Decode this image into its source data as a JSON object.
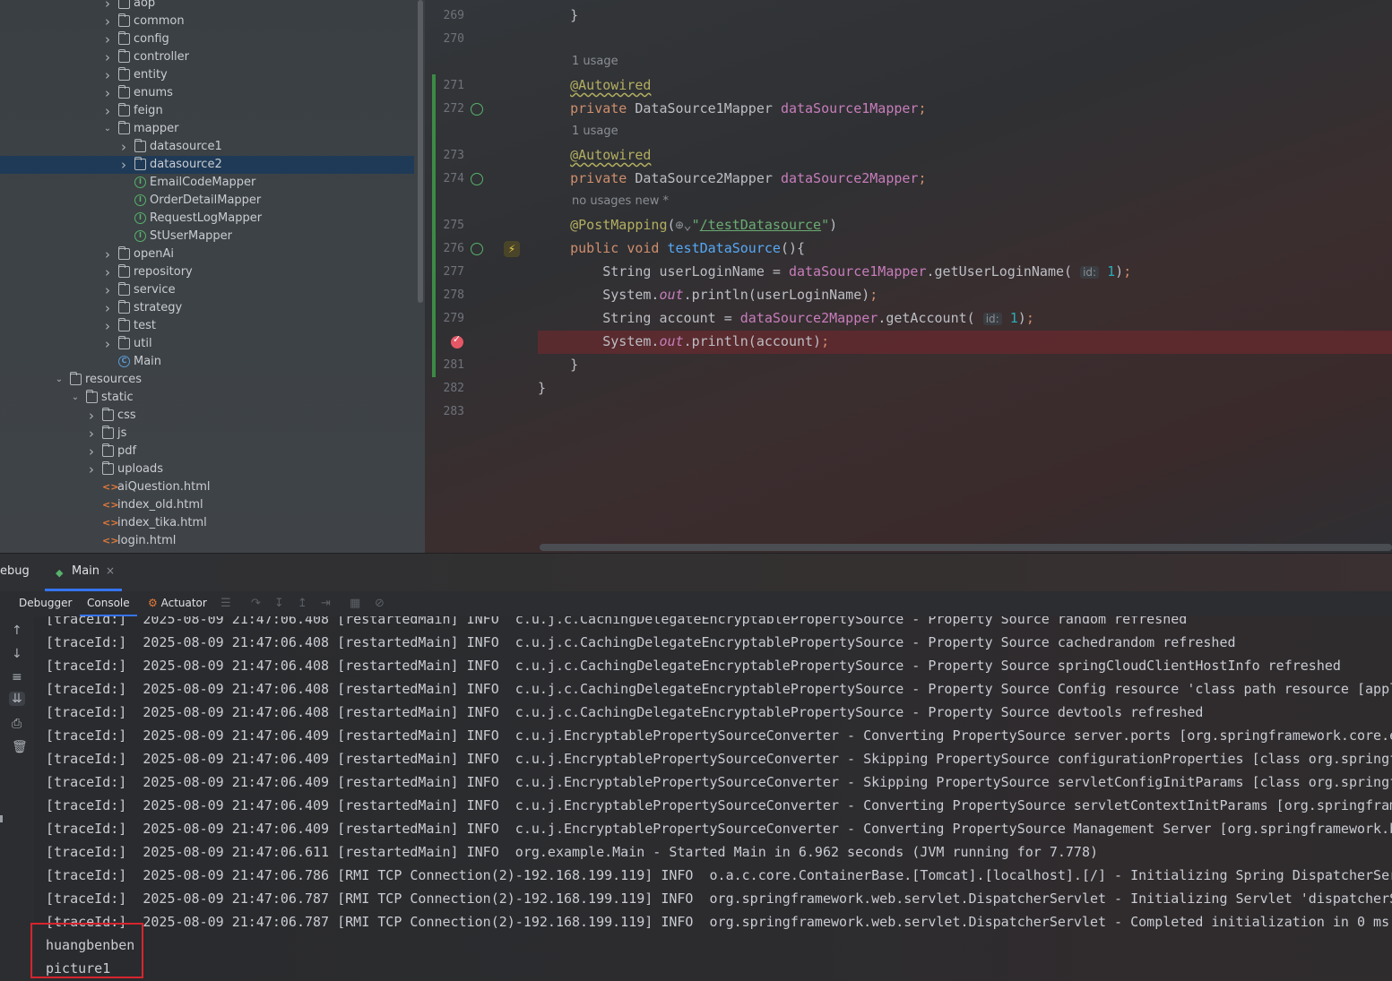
{
  "project_tree": {
    "items": [
      {
        "label": "aop",
        "type": "folder",
        "indent": 1,
        "expanded": false,
        "partial": true
      },
      {
        "label": "common",
        "type": "folder",
        "indent": 1,
        "expanded": false
      },
      {
        "label": "config",
        "type": "folder",
        "indent": 1,
        "expanded": false
      },
      {
        "label": "controller",
        "type": "folder",
        "indent": 1,
        "expanded": false
      },
      {
        "label": "entity",
        "type": "folder",
        "indent": 1,
        "expanded": false
      },
      {
        "label": "enums",
        "type": "folder",
        "indent": 1,
        "expanded": false
      },
      {
        "label": "feign",
        "type": "folder",
        "indent": 1,
        "expanded": false
      },
      {
        "label": "mapper",
        "type": "folder",
        "indent": 1,
        "expanded": true
      },
      {
        "label": "datasource1",
        "type": "folder",
        "indent": 2,
        "expanded": false
      },
      {
        "label": "datasource2",
        "type": "folder",
        "indent": 2,
        "expanded": false,
        "selected": true
      },
      {
        "label": "EmailCodeMapper",
        "type": "interface",
        "indent": 2
      },
      {
        "label": "OrderDetailMapper",
        "type": "interface",
        "indent": 2
      },
      {
        "label": "RequestLogMapper",
        "type": "interface",
        "indent": 2
      },
      {
        "label": "StUserMapper",
        "type": "interface",
        "indent": 2
      },
      {
        "label": "openAi",
        "type": "folder",
        "indent": 1,
        "expanded": false
      },
      {
        "label": "repository",
        "type": "folder",
        "indent": 1,
        "expanded": false
      },
      {
        "label": "service",
        "type": "folder",
        "indent": 1,
        "expanded": false
      },
      {
        "label": "strategy",
        "type": "folder",
        "indent": 1,
        "expanded": false
      },
      {
        "label": "test",
        "type": "folder",
        "indent": 1,
        "expanded": false
      },
      {
        "label": "util",
        "type": "folder",
        "indent": 1,
        "expanded": false
      },
      {
        "label": "Main",
        "type": "class",
        "indent": 1
      },
      {
        "label": "resources",
        "type": "folder",
        "indent": -2,
        "expanded": true
      },
      {
        "label": "static",
        "type": "folder",
        "indent": -1,
        "expanded": true
      },
      {
        "label": "css",
        "type": "folder",
        "indent": 0,
        "expanded": false
      },
      {
        "label": "js",
        "type": "folder",
        "indent": 0,
        "expanded": false
      },
      {
        "label": "pdf",
        "type": "folder",
        "indent": 0,
        "expanded": false
      },
      {
        "label": "uploads",
        "type": "folder",
        "indent": 0,
        "expanded": false
      },
      {
        "label": "aiQuestion.html",
        "type": "html",
        "indent": 0
      },
      {
        "label": "index_old.html",
        "type": "html",
        "indent": 0
      },
      {
        "label": "index_tika.html",
        "type": "html",
        "indent": 0
      },
      {
        "label": "login.html",
        "type": "html",
        "indent": 0
      }
    ]
  },
  "editor": {
    "lines": [
      {
        "num": "269",
        "html": "    }"
      },
      {
        "num": "270",
        "html": ""
      },
      {
        "hint": "1 usage"
      },
      {
        "num": "271",
        "html": "    <span class=\"ann\">@Autowired</span>",
        "changed": true
      },
      {
        "num": "272",
        "html": "    <span class=\"kw\">private</span> DataSource1Mapper <span class=\"fld\">dataSource1Mapper</span><span class=\"kw\">;</span>",
        "changed": true,
        "icon": "bean-nav"
      },
      {
        "hint": "1 usage",
        "changed": true
      },
      {
        "num": "273",
        "html": "    <span class=\"ann\">@Autowired</span>",
        "changed": true
      },
      {
        "num": "274",
        "html": "    <span class=\"kw\">private</span> DataSource2Mapper <span class=\"fld\">dataSource2Mapper</span><span class=\"kw\">;</span>",
        "changed": true,
        "icon": "bean-nav"
      },
      {
        "hint": "no usages   new *",
        "changed": true
      },
      {
        "num": "275",
        "html": "    <span class=\"annp\">@PostMapping</span>(<span style=\"color:#8a8e94\">⊕⌄</span><span class=\"str\">\"<u>/testDatasource</u>\"</span>)",
        "changed": true
      },
      {
        "num": "276",
        "html": "    <span class=\"kw\">public void</span> <span class=\"fn\">testDataSource</span>(){",
        "changed": true,
        "icon": "web-endpoint"
      },
      {
        "num": "277",
        "html": "        String userLoginName = <span class=\"fld\">dataSource1Mapper</span>.getUserLoginName( <span class=\"param-hint\">id:</span> <span class=\"num\">1</span>)<span class=\"kw\">;</span>",
        "changed": true
      },
      {
        "num": "278",
        "html": "        System.<span class=\"fld it\">out</span>.println(userLoginName)<span class=\"kw\">;</span>",
        "changed": true
      },
      {
        "num": "279",
        "html": "        String account = <span class=\"fld\">dataSource2Mapper</span>.getAccount( <span class=\"param-hint\">id:</span> <span class=\"num\">1</span>)<span class=\"kw\">;</span>",
        "changed": true
      },
      {
        "num": "",
        "html": "        System.<span class=\"fld it\">out</span>.println(account)<span class=\"kw\">;</span>",
        "changed": true,
        "breakpoint": true
      },
      {
        "num": "281",
        "html": "    }",
        "changed": true
      },
      {
        "num": "282",
        "html": "}"
      },
      {
        "num": "283",
        "html": ""
      }
    ]
  },
  "debug": {
    "title": "ebug",
    "session_tab": "Main",
    "session_close": "×",
    "tabs": {
      "debugger": "Debugger",
      "console": "Console",
      "actuator": "Actuator"
    },
    "console_lines": [
      "[traceId:]  2025-08-09 21:47:06.408 [restartedMain] INFO  c.u.j.c.CachingDelegateEncryptablePropertySource - Property Source random refreshed",
      "[traceId:]  2025-08-09 21:47:06.408 [restartedMain] INFO  c.u.j.c.CachingDelegateEncryptablePropertySource - Property Source cachedrandom refreshed",
      "[traceId:]  2025-08-09 21:47:06.408 [restartedMain] INFO  c.u.j.c.CachingDelegateEncryptablePropertySource - Property Source springCloudClientHostInfo refreshed",
      "[traceId:]  2025-08-09 21:47:06.408 [restartedMain] INFO  c.u.j.c.CachingDelegateEncryptablePropertySource - Property Source Config resource 'class path resource [appl",
      "[traceId:]  2025-08-09 21:47:06.408 [restartedMain] INFO  c.u.j.c.CachingDelegateEncryptablePropertySource - Property Source devtools refreshed",
      "[traceId:]  2025-08-09 21:47:06.409 [restartedMain] INFO  c.u.j.EncryptablePropertySourceConverter - Converting PropertySource server.ports [org.springframework.core.e",
      "[traceId:]  2025-08-09 21:47:06.409 [restartedMain] INFO  c.u.j.EncryptablePropertySourceConverter - Skipping PropertySource configurationProperties [class org.springf",
      "[traceId:]  2025-08-09 21:47:06.409 [restartedMain] INFO  c.u.j.EncryptablePropertySourceConverter - Skipping PropertySource servletConfigInitParams [class org.springf",
      "[traceId:]  2025-08-09 21:47:06.409 [restartedMain] INFO  c.u.j.EncryptablePropertySourceConverter - Converting PropertySource servletContextInitParams [org.springfram",
      "[traceId:]  2025-08-09 21:47:06.409 [restartedMain] INFO  c.u.j.EncryptablePropertySourceConverter - Converting PropertySource Management Server [org.springframework.b",
      "[traceId:]  2025-08-09 21:47:06.611 [restartedMain] INFO  org.example.Main - Started Main in 6.962 seconds (JVM running for 7.778)",
      "[traceId:]  2025-08-09 21:47:06.786 [RMI TCP Connection(2)-192.168.199.119] INFO  o.a.c.core.ContainerBase.[Tomcat].[localhost].[/] - Initializing Spring DispatcherSer",
      "[traceId:]  2025-08-09 21:47:06.787 [RMI TCP Connection(2)-192.168.199.119] INFO  org.springframework.web.servlet.DispatcherServlet - Initializing Servlet 'dispatcherS",
      "[traceId:]  2025-08-09 21:47:06.787 [RMI TCP Connection(2)-192.168.199.119] INFO  org.springframework.web.servlet.DispatcherServlet - Completed initialization in 0 ms",
      "huangbenben",
      "picture1"
    ]
  }
}
